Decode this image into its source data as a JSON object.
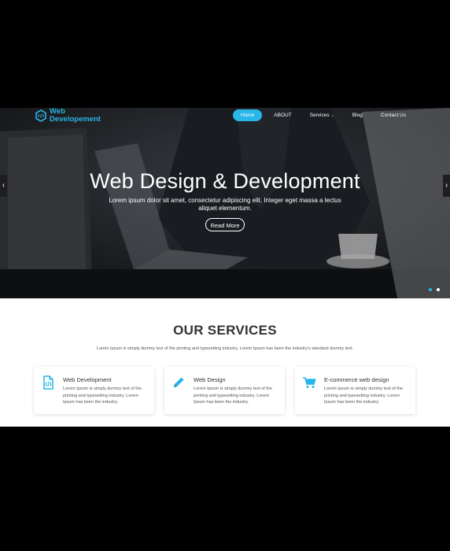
{
  "logo": {
    "line1": "Web",
    "line2": "Developement"
  },
  "nav": {
    "items": [
      {
        "label": "Home",
        "active": true
      },
      {
        "label": "ABOUT"
      },
      {
        "label": "Services",
        "caret": true
      },
      {
        "label": "Blog"
      },
      {
        "label": "Contact Us"
      }
    ]
  },
  "hero": {
    "title": "Web Design & Development",
    "subtitle": "Lorem ipsum dolor sit amet, consectetur adipiscing elit. Integer eget massa a lectus aliquet elementum.",
    "button": "Read More",
    "prev_arrow": "‹",
    "next_arrow": "›"
  },
  "services": {
    "title": "OUR SERVICES",
    "description": "Lorem Ipsum is simply dummy text of the printing and typesetting industry. Lorem Ipsum has been the industry's standard dummy text.",
    "cards": [
      {
        "icon": "code-file-icon",
        "title": "Web Development",
        "text": "Lorem Ipsum is simply dummy text of the printing and typesetting industry. Lorem Ipsum has been the industry."
      },
      {
        "icon": "pencil-icon",
        "title": "Web Design",
        "text": "Lorem Ipsum is simply dummy text of the printing and typesetting industry. Lorem Ipsum has been the industry."
      },
      {
        "icon": "cart-icon",
        "title": "E-commerce web design",
        "text": "Lorem Ipsum is simply dummy text of the printing and typesetting industry. Lorem Ipsum has been the industry."
      }
    ]
  },
  "colors": {
    "accent": "#29b6e8",
    "background": "#000000",
    "card": "#ffffff"
  }
}
